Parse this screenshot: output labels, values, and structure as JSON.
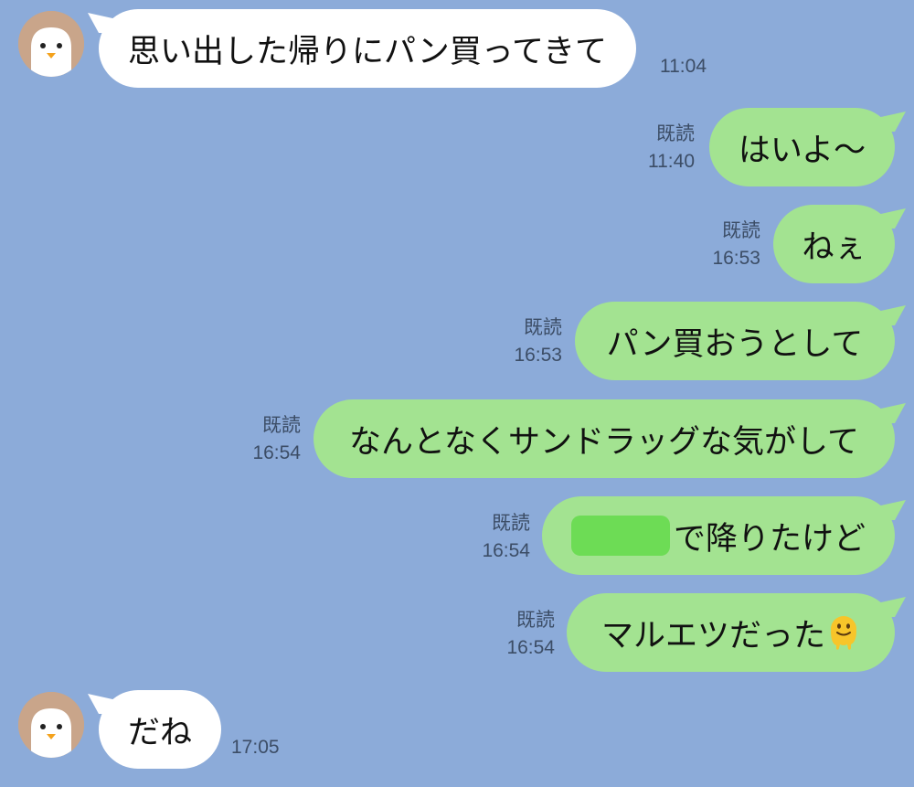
{
  "chat": {
    "messages": [
      {
        "from": "other",
        "text": "思い出した帰りにパン買ってきて",
        "time": "11:04"
      },
      {
        "from": "me",
        "text": "はいよ〜",
        "read": "既読",
        "time": "11:40"
      },
      {
        "from": "me",
        "text": "ねぇ",
        "read": "既読",
        "time": "16:53"
      },
      {
        "from": "me",
        "text": "パン買おうとして",
        "read": "既読",
        "time": "16:53"
      },
      {
        "from": "me",
        "text": "なんとなくサンドラッグな気がして",
        "read": "既読",
        "time": "16:54"
      },
      {
        "from": "me",
        "text": "で降りたけど",
        "read": "既読",
        "time": "16:54"
      },
      {
        "from": "me",
        "text": "マルエツだった",
        "read": "既読",
        "time": "16:54",
        "emoji": "melting-face-emoji"
      },
      {
        "from": "other",
        "text": "だね",
        "time": "17:05"
      }
    ]
  },
  "colors": {
    "background": "#8cabd9",
    "incoming_bubble": "#ffffff",
    "outgoing_bubble": "#a3e391",
    "redaction": "#6ddc55"
  },
  "icons": {
    "avatar": "penguin-avatar-icon",
    "redacted": "redacted-block"
  }
}
